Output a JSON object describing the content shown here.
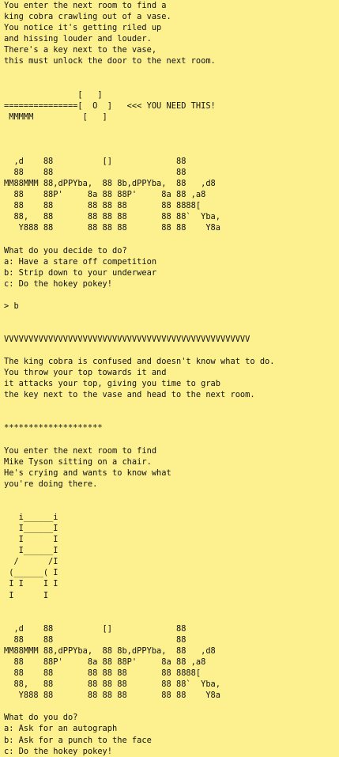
{
  "terminal": {
    "intro": "You enter the next room to find a\nking cobra crawling out of a vase.\nYou notice it's getting riled up\nand hissing louder and louder.\nThere's a key next to the vase,\nthis must unlock the door to the next room.",
    "key_art": "               [   ]\n===============[  O  ]   <<< YOU NEED THIS!\n MMMMM          [   ]",
    "title_art_1": "  ,d    88          []             88\n  88    88                         88\nMM88MMM 88,dPPYba,  88 8b,dPPYba,  88   ,d8\n  88    88P'     8a 88 88P'     8a 88 ,a8\n  88    88       88 88 88       88 8888[\n  88,   88       88 88 88       88 88`  Yba,\n   Y888 88       88 88 88       88 88    Y8a",
    "question_1": "What do you decide to do?",
    "options_1": [
      "a: Have a stare off competition",
      "b: Strip down to your underwear",
      "c: Do the hokey pokey!"
    ],
    "input_prompt": "> b",
    "divider_v": "VVVVVVVVVVVVVVVVVVVVVVVVVVVVVVVVVVVVVVVVVVVVVVVVVV",
    "result_1": "The king cobra is confused and doesn't know what to do.\nYou throw your top towards it and\nit attacks your top, giving you time to grab\nthe key next to the vase and head to the next room.",
    "divider_star": "********************",
    "intro_2": "You enter the next room to find\nMike Tyson sitting on a chair.\nHe's crying and wants to know what\nyou're doing there.",
    "chair_art": "   i______i\n   I______I\n   I      I\n   I______I\n  /      /I\n (______( I\n I I    I I\n I      I",
    "title_art_2": "  ,d    88          []             88\n  88    88                         88\nMM88MMM 88,dPPYba,  88 8b,dPPYba,  88   ,d8\n  88    88P'     8a 88 88P'     8a 88 ,a8\n  88    88       88 88 88       88 8888[\n  88,   88       88 88 88       88 88`  Yba,\n   Y888 88       88 88 88       88 88    Y8a",
    "question_2": "What do you do?",
    "options_2": [
      "a: Ask for an autograph",
      "b: Ask for a punch to the face",
      "c: Do the hokey pokey!"
    ]
  }
}
